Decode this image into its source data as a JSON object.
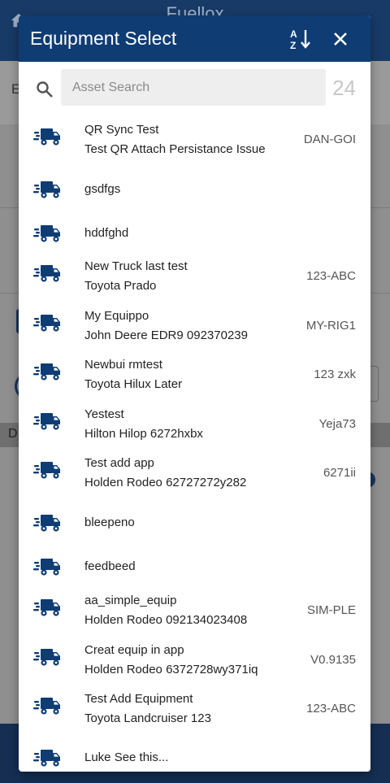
{
  "background": {
    "title": "Fuellox",
    "side_letter_1": "E",
    "side_letter_2": "D"
  },
  "modal": {
    "title": "Equipment Select",
    "sort_icon": "sort-alpha-icon",
    "close_icon": "close-icon"
  },
  "search": {
    "placeholder": "Asset Search",
    "value": "",
    "count": "24"
  },
  "equipment": [
    {
      "name": "QR Sync Test",
      "detail": "Test QR Attach Persistance Issue",
      "code": "DAN-GOI"
    },
    {
      "name": "gsdfgs",
      "detail": "",
      "code": ""
    },
    {
      "name": "hddfghd",
      "detail": "",
      "code": ""
    },
    {
      "name": "New Truck last test",
      "detail": "Toyota Prado",
      "code": "123-ABC"
    },
    {
      "name": "My Equippo",
      "detail": "John Deere EDR9 092370239",
      "code": "MY-RIG1"
    },
    {
      "name": "Newbui rmtest",
      "detail": "Toyota Hilux Later",
      "code": "123 zxk"
    },
    {
      "name": "Yestest",
      "detail": "Hilton Hilop 6272hxbx",
      "code": "Yeja73"
    },
    {
      "name": "Test add app",
      "detail": "Holden Rodeo 62727272y282",
      "code": "6271ii"
    },
    {
      "name": "bleepeno",
      "detail": "",
      "code": ""
    },
    {
      "name": "feedbeed",
      "detail": "",
      "code": ""
    },
    {
      "name": "aa_simple_equip",
      "detail": "Holden Rodeo 092134023408",
      "code": "SIM-PLE"
    },
    {
      "name": "Creat equip in app",
      "detail": "Holden Rodeo 6372728wy371iq",
      "code": "V0.9135"
    },
    {
      "name": "Test Add Equipment",
      "detail": "Toyota Landcruiser 123",
      "code": "123-ABC"
    },
    {
      "name": "Luke See this...",
      "detail": "",
      "code": ""
    }
  ],
  "colors": {
    "header": "#0f3c73",
    "icon": "#0f3c73",
    "overlay_header": "#183a66"
  }
}
